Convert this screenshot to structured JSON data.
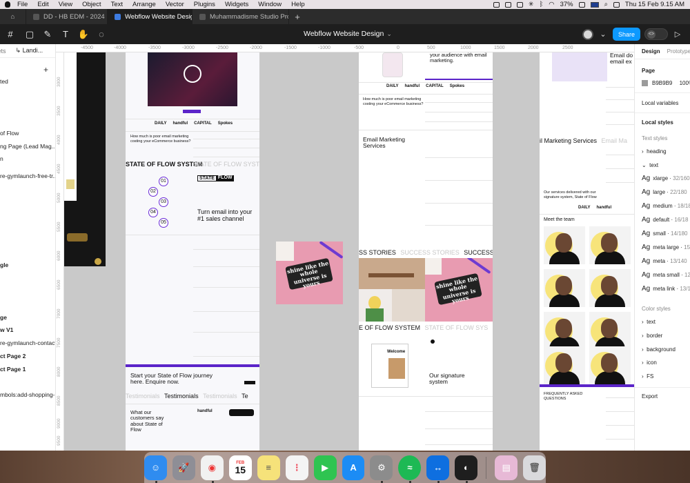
{
  "menubar": {
    "items": [
      "File",
      "Edit",
      "View",
      "Object",
      "Text",
      "Arrange",
      "Vector",
      "Plugins",
      "Widgets",
      "Window",
      "Help"
    ],
    "battery": "37%",
    "datetime": "Thu 15 Feb  9.15 AM"
  },
  "tabs": [
    {
      "label": "DD - HB EDM - 2024"
    },
    {
      "label": "Webflow Website Design"
    },
    {
      "label": "Muhammadisme Studio Project"
    }
  ],
  "toolbar": {
    "doc_title": "Webflow Website Design",
    "share_label": "Share"
  },
  "layers": {
    "tab_assets": "sets",
    "page_name": "Landi...",
    "rows": [
      {
        "label": "ted",
        "bold": false
      },
      {
        "label": "of Flow",
        "bold": false
      },
      {
        "label": "ng Page (Lead Mag...",
        "bold": false
      },
      {
        "label": "n",
        "bold": false
      },
      {
        "label": "re-gymlaunch-free-tr...",
        "bold": false
      },
      {
        "label": "gle",
        "bold": true
      },
      {
        "label": "ge",
        "bold": true
      },
      {
        "label": "w V1",
        "bold": true
      },
      {
        "label": "re-gymlaunch-contact...",
        "bold": false
      },
      {
        "label": "ct Page 2",
        "bold": true
      },
      {
        "label": "ct Page 1",
        "bold": true
      },
      {
        "label": "mbols:add-shopping-...",
        "bold": false
      }
    ]
  },
  "ruler": {
    "h": [
      "-4500",
      "-4000",
      "-3500",
      "-3000",
      "-2500",
      "-2000",
      "-1500",
      "-1000",
      "-500",
      "0",
      "500",
      "1000",
      "1500",
      "2000",
      "2500"
    ],
    "v": [
      "3000",
      "3500",
      "4000",
      "4500",
      "5000",
      "5500",
      "6000",
      "6500",
      "7000",
      "7500",
      "8000",
      "8500",
      "9000",
      "9500"
    ]
  },
  "canvas": {
    "frame_b": {
      "q1": "How much is poor email marketing costing your eCommerce business?",
      "state_of_flow_1": "STATE OF FLOW SYSTEM",
      "state_of_flow_2": "STATE OF FLOW SYSTE",
      "badge": "STATE",
      "badge2": "FLOW",
      "headline": "Turn email into your #1 sales channel",
      "steps": [
        "01",
        "02",
        "03",
        "04",
        "05"
      ],
      "cta": "Start your State of Flow journey here. Enquire now.",
      "testimonials": [
        "Testimonials",
        "Testimonials",
        "Testimonials",
        "Te"
      ],
      "what_customers": "What our customers say about State of Flow",
      "logo_handful": "handful",
      "logos": [
        "DAILY",
        "handful",
        "CAPITAL",
        "Spokes"
      ]
    },
    "frame_c": {
      "audience": "your audience with email marketing.",
      "q1": "How much is poor email marketing costing your eCommerce business?",
      "services": "Email Marketing Services",
      "success": [
        "SS STORIES",
        "SUCCESS STORIES",
        "SUCCESS ST"
      ],
      "flow": "E OF FLOW SYSTEM",
      "flow2": "STATE OF FLOW SYS",
      "signature": "Our signature system",
      "welcome": "Welcome",
      "logos": [
        "DAILY",
        "handful",
        "CAPITAL",
        "Spokes"
      ]
    },
    "frame_d": {
      "email_ex": "Email do email ex",
      "services": "il Marketing Services",
      "services2": "Email Ma",
      "delivered": "Our services delivered with our signature system, State of Flow",
      "meet": "Meet the team",
      "faq": "FREQUENTLY ASKED QUESTIONS",
      "logos": [
        "DAILY",
        "handful"
      ]
    },
    "sticker_text": "shine like the whole universe is yours"
  },
  "design_panel": {
    "tabs": [
      "Design",
      "Prototype"
    ],
    "page_label": "Page",
    "page_color": "B9B9B9",
    "page_opacity": "100%",
    "local_variables": "Local variables",
    "local_styles": "Local styles",
    "text_styles": "Text styles",
    "groups": [
      "heading",
      "text"
    ],
    "text_style_items": [
      {
        "name": "xlarge",
        "meta": "32/160"
      },
      {
        "name": "large",
        "meta": "22/180"
      },
      {
        "name": "medium",
        "meta": "18/180"
      },
      {
        "name": "default",
        "meta": "16/18"
      },
      {
        "name": "small",
        "meta": "14/180"
      },
      {
        "name": "meta large",
        "meta": "15/"
      },
      {
        "name": "meta",
        "meta": "13/140"
      },
      {
        "name": "meta small",
        "meta": "12"
      },
      {
        "name": "meta link",
        "meta": "13/14"
      }
    ],
    "color_styles": "Color styles",
    "color_groups": [
      "text",
      "border",
      "background",
      "icon",
      "FS"
    ],
    "export": "Export"
  },
  "dock": {
    "apps": [
      {
        "name": "finder",
        "color": "#2f8cf0"
      },
      {
        "name": "launchpad",
        "color": "#8e8e96"
      },
      {
        "name": "chrome",
        "color": "#f1f1f1"
      },
      {
        "name": "calendar",
        "color": "#ffffff"
      },
      {
        "name": "notes",
        "color": "#f6e27a"
      },
      {
        "name": "reminders",
        "color": "#f4f4f4"
      },
      {
        "name": "facetime",
        "color": "#2fc451"
      },
      {
        "name": "app-store",
        "color": "#1c8cf5"
      },
      {
        "name": "system-settings",
        "color": "#8c8c8c"
      },
      {
        "name": "spotify",
        "color": "#1db954"
      },
      {
        "name": "teamviewer",
        "color": "#0e6fe0"
      },
      {
        "name": "figma",
        "color": "#1e1e1e"
      },
      {
        "name": "downloads",
        "color": "#e7b9d6"
      },
      {
        "name": "trash",
        "color": "#d9d9dc"
      }
    ],
    "calendar_month": "FEB",
    "calendar_day": "15"
  }
}
